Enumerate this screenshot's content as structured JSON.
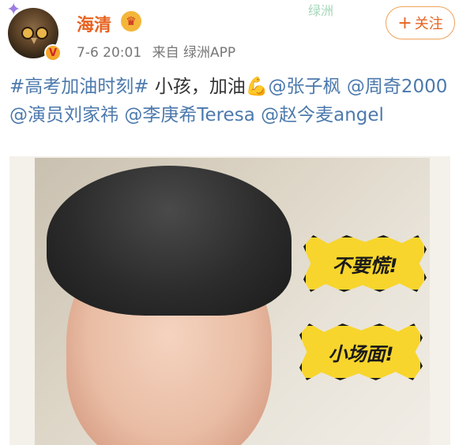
{
  "post": {
    "username": "海清",
    "time": "7-6 20:01",
    "source": "来自 绿洲APP",
    "follow_label": "关注",
    "text": {
      "tag": "#高考加油时刻#",
      "body": " 小孩，加油💪",
      "mentions": [
        "@张子枫",
        "@周奇2000",
        "@演员刘家祎",
        "@李庚希Teresa",
        "@赵今麦angel"
      ]
    },
    "image_captions": [
      "不要慌!",
      "小场面!"
    ]
  },
  "decor": {
    "oasis_text": "绿洲"
  },
  "icons": [
    "crown-icon",
    "verified-icon",
    "plus-icon"
  ],
  "colors": {
    "username": "#e86320",
    "link": "#4c79ad",
    "follow_border": "#f0a35a",
    "bubble": "#f7d52c"
  }
}
